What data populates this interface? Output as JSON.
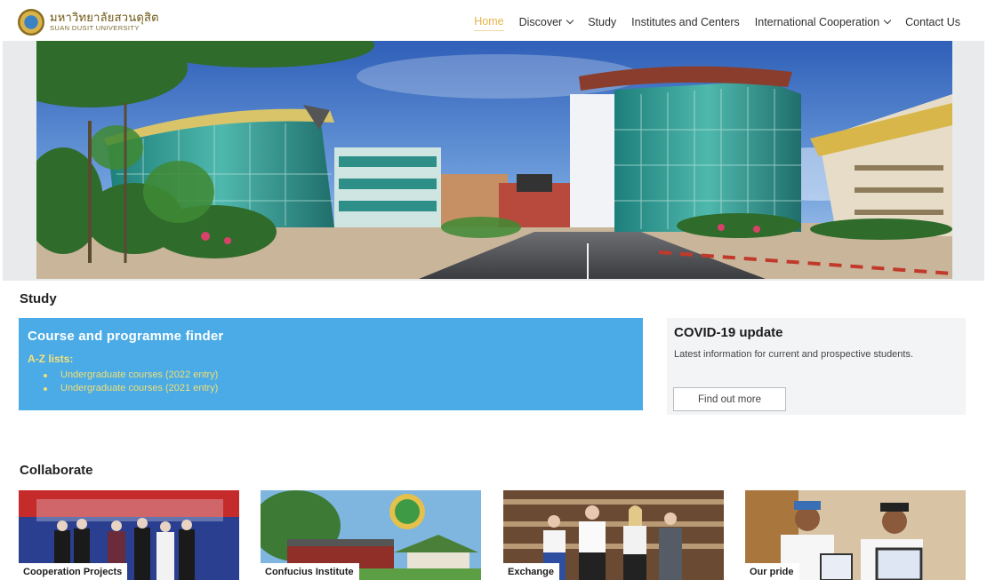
{
  "header": {
    "logo_thai": "มหาวิทยาลัยสวนดุสิต",
    "logo_english": "SUAN DUSIT UNIVERSITY",
    "nav": [
      {
        "label": "Home",
        "active": true,
        "dropdown": false
      },
      {
        "label": "Discover",
        "active": false,
        "dropdown": true
      },
      {
        "label": "Study",
        "active": false,
        "dropdown": false
      },
      {
        "label": "Institutes and Centers",
        "active": false,
        "dropdown": false
      },
      {
        "label": "International Cooperation",
        "active": false,
        "dropdown": true
      },
      {
        "label": "Contact Us",
        "active": false,
        "dropdown": false
      }
    ]
  },
  "study": {
    "heading": "Study",
    "finder": {
      "title": "Course and programme finder",
      "subtitle": "A-Z lists:",
      "links": [
        "Undergraduate courses (2022 entry)",
        "Undergraduate courses (2021 entry)"
      ]
    },
    "covid": {
      "title": "COVID-19 update",
      "text": "Latest information for current and prospective students.",
      "button": "Find out more"
    }
  },
  "collaborate": {
    "heading": "Collaborate",
    "cards": [
      {
        "label": "Cooperation Projects"
      },
      {
        "label": "Confucius Institute"
      },
      {
        "label": "Exchange"
      },
      {
        "label": "Our pride"
      }
    ]
  },
  "colors": {
    "accent_gold": "#e6b34a",
    "finder_blue": "#4aabe6",
    "finder_link_yellow": "#f4df72",
    "covid_panel": "#f3f4f6"
  }
}
